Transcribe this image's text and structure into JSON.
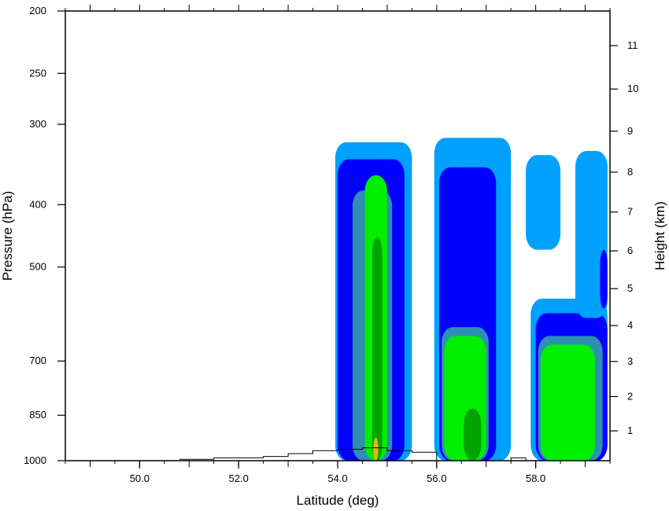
{
  "chart_data": {
    "type": "heatmap",
    "xlabel": "Latitude (deg)",
    "ylabel": "Pressure (hPa)",
    "y2label": "Height (km)",
    "xlim": [
      48.5,
      59.5
    ],
    "ylim": [
      1000,
      200
    ],
    "y_scale": "log",
    "x_ticks": [
      {
        "value": 50.0,
        "label": "50.0"
      },
      {
        "value": 52.0,
        "label": "52.0"
      },
      {
        "value": 54.0,
        "label": "54.0"
      },
      {
        "value": 56.0,
        "label": "56.0"
      },
      {
        "value": 58.0,
        "label": "58.0"
      }
    ],
    "y_ticks": [
      {
        "value": 200,
        "label": "200"
      },
      {
        "value": 250,
        "label": "250"
      },
      {
        "value": 300,
        "label": "300"
      },
      {
        "value": 400,
        "label": "400"
      },
      {
        "value": 500,
        "label": "500"
      },
      {
        "value": 700,
        "label": "700"
      },
      {
        "value": 850,
        "label": "850"
      },
      {
        "value": 1000,
        "label": "1000"
      }
    ],
    "y2_ticks": [
      {
        "value": 1,
        "label": "1"
      },
      {
        "value": 2,
        "label": "2"
      },
      {
        "value": 3,
        "label": "3"
      },
      {
        "value": 4,
        "label": "4"
      },
      {
        "value": 5,
        "label": "5"
      },
      {
        "value": 6,
        "label": "6"
      },
      {
        "value": 7,
        "label": "7"
      },
      {
        "value": 8,
        "label": "8"
      },
      {
        "value": 9,
        "label": "9"
      },
      {
        "value": 10,
        "label": "10"
      },
      {
        "value": 11,
        "label": "11"
      }
    ],
    "colors": {
      "level1": "#00a0ff",
      "level2": "#0000ff",
      "level3": "#2f8fb3",
      "level4": "#00ee00",
      "level5": "#00a300",
      "level6": "#e6b800",
      "terrain": "#000000"
    },
    "regions": [
      {
        "level": 1,
        "lat": [
          53.95,
          55.5
        ],
        "p": [
          1000,
          320
        ]
      },
      {
        "level": 2,
        "lat": [
          54.0,
          55.35
        ],
        "p": [
          1000,
          340
        ]
      },
      {
        "level": 3,
        "lat": [
          54.3,
          55.1
        ],
        "p": [
          1000,
          380
        ]
      },
      {
        "level": 4,
        "lat": [
          54.55,
          55.0
        ],
        "p": [
          1000,
          360
        ]
      },
      {
        "level": 5,
        "lat": [
          54.7,
          54.9
        ],
        "p": [
          1000,
          450
        ]
      },
      {
        "level": 6,
        "lat": [
          54.72,
          54.82
        ],
        "p": [
          1000,
          920
        ]
      },
      {
        "level": 1,
        "lat": [
          55.95,
          57.5
        ],
        "p": [
          1000,
          315
        ]
      },
      {
        "level": 2,
        "lat": [
          56.05,
          57.2
        ],
        "p": [
          1000,
          350
        ]
      },
      {
        "level": 3,
        "lat": [
          56.1,
          57.05
        ],
        "p": [
          1000,
          620
        ]
      },
      {
        "level": 4,
        "lat": [
          56.15,
          57.0
        ],
        "p": [
          1000,
          640
        ]
      },
      {
        "level": 5,
        "lat": [
          56.55,
          56.9
        ],
        "p": [
          1000,
          830
        ]
      },
      {
        "level": 1,
        "lat": [
          57.8,
          58.5
        ],
        "p": [
          470,
          335
        ]
      },
      {
        "level": 1,
        "lat": [
          57.9,
          59.45
        ],
        "p": [
          1000,
          560
        ]
      },
      {
        "level": 2,
        "lat": [
          58.0,
          59.45
        ],
        "p": [
          1000,
          590
        ]
      },
      {
        "level": 3,
        "lat": [
          58.05,
          59.35
        ],
        "p": [
          1000,
          640
        ]
      },
      {
        "level": 4,
        "lat": [
          58.1,
          59.2
        ],
        "p": [
          1000,
          660
        ]
      },
      {
        "level": 1,
        "lat": [
          58.8,
          59.45
        ],
        "p": [
          600,
          330
        ]
      },
      {
        "level": 2,
        "lat": [
          59.3,
          59.45
        ],
        "p": [
          580,
          470
        ]
      }
    ],
    "terrain_p_at_lat": [
      {
        "lat": 50.8,
        "p": 995
      },
      {
        "lat": 51.5,
        "p": 990
      },
      {
        "lat": 52.5,
        "p": 985
      },
      {
        "lat": 53.0,
        "p": 975
      },
      {
        "lat": 53.5,
        "p": 965
      },
      {
        "lat": 54.0,
        "p": 960
      },
      {
        "lat": 54.5,
        "p": 955
      },
      {
        "lat": 55.0,
        "p": 965
      },
      {
        "lat": 55.5,
        "p": 970
      },
      {
        "lat": 56.0,
        "p": 1000
      },
      {
        "lat": 57.5,
        "p": 990
      },
      {
        "lat": 57.8,
        "p": 1000
      }
    ]
  }
}
